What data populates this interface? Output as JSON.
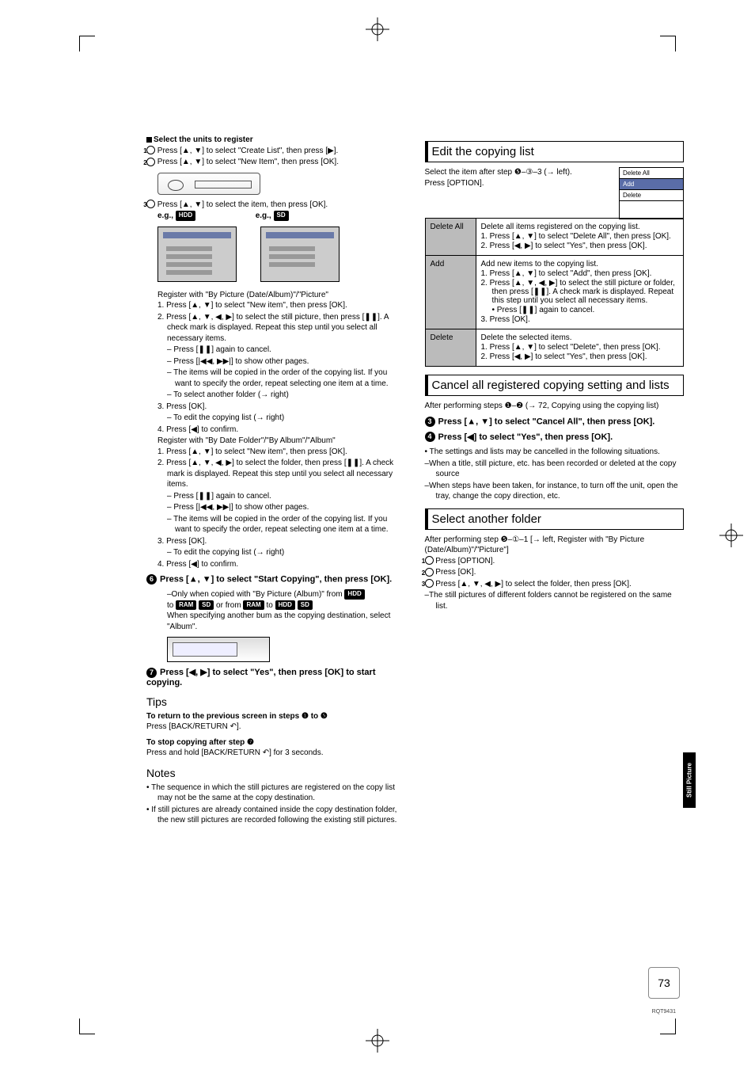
{
  "left": {
    "select_units_heading": "Select the units to register",
    "step1": "Press [▲, ▼] to select \"Create List\", then press [▶].",
    "step2": "Press [▲, ▼] to select \"New Item\", then press [OK].",
    "step3": "Press [▲, ▼] to select the item, then press [OK].",
    "eg_hdd_label": "e.g.,",
    "eg_hdd_badge": "HDD",
    "eg_sd_label": "e.g.,",
    "eg_sd_badge": "SD",
    "reg_a_title": "Register with \"By Picture (Date/Album)\"/\"Picture\"",
    "reg_a_1": "1.  Press [▲, ▼] to select \"New item\", then press [OK].",
    "reg_a_2": "2.  Press [▲, ▼, ◀, ▶] to select the still picture, then press [❚❚]. A check mark is displayed. Repeat this step until you select all necessary items.",
    "reg_a_2a": "– Press [❚❚] again to cancel.",
    "reg_a_2b": "– Press [|◀◀, ▶▶|] to show other pages.",
    "reg_a_2c": "– The items will be copied in the order of the copying list. If you want to specify the order, repeat selecting one item at a time.",
    "reg_a_2d": "– To select another folder (→ right)",
    "reg_a_3": "3.  Press [OK].",
    "reg_a_3a": "– To edit the copying list (→ right)",
    "reg_a_4": "4.  Press [◀] to confirm.",
    "reg_b_title": "Register with \"By Date Folder\"/\"By Album\"/\"Album\"",
    "reg_b_1": "1.  Press [▲, ▼] to select \"New item\", then press [OK].",
    "reg_b_2": "2.  Press [▲, ▼, ◀, ▶] to select the folder, then press [❚❚]. A check mark is displayed. Repeat this step until you select all necessary items.",
    "reg_b_2a": "– Press [❚❚] again to cancel.",
    "reg_b_2b": "– Press [|◀◀, ▶▶|] to show other pages.",
    "reg_b_2c": "– The items will be copied in the order of the copying list. If you want to specify the order, repeat selecting one item at a time.",
    "reg_b_3": "3.  Press [OK].",
    "reg_b_3a": "– To edit the copying list (→ right)",
    "reg_b_4": "4.  Press [◀] to confirm.",
    "step6_num": "6",
    "step6": "Press [▲, ▼] to select \"Start Copying\", then press [OK].",
    "step6_note1": "–Only when copied with \"By Picture (Album)\" from",
    "step6_badge_hdd": "HDD",
    "step6_note2": "to",
    "step6_badge_ram": "RAM",
    "step6_badge_sd": "SD",
    "step6_note3": "or from",
    "step6_badge_ram2": "RAM",
    "step6_note4": "to",
    "step6_badge_hdd2": "HDD",
    "step6_badge_sd2": "SD",
    "step6_note5": "When specifying another bum as the copying destination, select \"Album\".",
    "step7_num": "7",
    "step7": "Press [◀, ▶] to select \"Yes\", then press [OK] to start copying.",
    "tips_heading": "Tips",
    "tips_1_bold": "To return to the previous screen in steps ❶ to ❺",
    "tips_1": "Press [BACK/RETURN ↶].",
    "tips_2_bold": "To stop copying after step ❼",
    "tips_2": "Press and hold [BACK/RETURN ↶] for 3 seconds.",
    "notes_heading": "Notes",
    "notes_1": "The sequence in which the still pictures are registered on the copy list may not be the same at the copy destination.",
    "notes_2": "If still pictures are already contained inside the copy destination folder, the new still pictures are recorded following the existing still pictures."
  },
  "right": {
    "edit_heading": "Edit the copying list",
    "edit_intro1": "Select the item after step ❺–③–3 (→ left).",
    "edit_intro2": "Press [OPTION].",
    "menu": {
      "delete_all": "Delete All",
      "add": "Add",
      "delete": "Delete"
    },
    "table": {
      "row1_h": "Delete All",
      "row1_b1": "Delete all items registered on the copying list.",
      "row1_b2": "1.  Press [▲, ▼] to select \"Delete All\", then press [OK].",
      "row1_b3": "2.  Press [◀, ▶] to select \"Yes\", then press [OK].",
      "row2_h": "Add",
      "row2_b1": "Add new items to the copying list.",
      "row2_b2": "1.  Press [▲, ▼] to select \"Add\", then press [OK].",
      "row2_b3": "2.  Press [▲, ▼, ◀, ▶] to select the still picture or folder, then press [❚❚]. A check mark is displayed. Repeat this step until you select all necessary items.",
      "row2_b3a": "• Press [❚❚] again to cancel.",
      "row2_b4": "3.  Press [OK].",
      "row3_h": "Delete",
      "row3_b1": "Delete the selected items.",
      "row3_b2": "1.  Press [▲, ▼] to select \"Delete\", then press [OK].",
      "row3_b3": "2.  Press [◀, ▶] to select \"Yes\", then press [OK]."
    },
    "cancel_heading": "Cancel all registered copying setting and lists",
    "cancel_intro": "After performing steps ❶–❷ (→ 72, Copying using the copying list)",
    "cancel_s3_num": "3",
    "cancel_s3": "Press [▲, ▼] to select \"Cancel All\", then press [OK].",
    "cancel_s4_num": "4",
    "cancel_s4": "Press [◀] to select \"Yes\", then press [OK].",
    "cancel_b1": "• The settings and lists may be cancelled in the following situations.",
    "cancel_b1a": "–When a title, still picture, etc. has been recorded or deleted at the copy source",
    "cancel_b1b": "–When steps have been taken, for instance, to turn off the unit, open the tray, change the copy direction, etc.",
    "select_heading": "Select another folder",
    "select_intro": "After performing step ❺–①–1 [→ left, Register with \"By Picture (Date/Album)\"/\"Picture\"]",
    "select_1": "Press [OPTION].",
    "select_2": "Press [OK].",
    "select_3": "Press [▲, ▼, ◀, ▶] to select the folder, then press [OK].",
    "select_3a": "–The still pictures of different folders cannot be registered on the same list."
  },
  "side_tab": "Still Picture",
  "page_num": "73",
  "footer_code": "RQT9431"
}
